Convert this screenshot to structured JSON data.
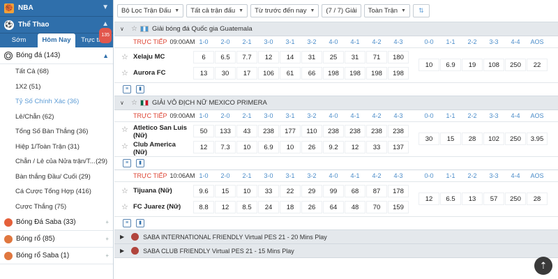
{
  "sidebar": {
    "nba_label": "NBA",
    "sport_label": "Thể Thao",
    "tabs": [
      "Sớm",
      "Hôm Nay",
      "Trực tiếp"
    ],
    "live_badge": "135",
    "football": {
      "label": "Bóng đá",
      "count": "(143)"
    },
    "menu": [
      {
        "label": "Tất Cả",
        "count": "(68)"
      },
      {
        "label": "1X2",
        "count": "(51)"
      },
      {
        "label": "Tỷ Số Chính Xác",
        "count": "(36)"
      },
      {
        "label": "Lẻ/Chẵn",
        "count": "(62)"
      },
      {
        "label": "Tổng Số Bàn Thắng",
        "count": "(36)"
      },
      {
        "label": "Hiệp 1/Toàn Trận",
        "count": "(31)"
      },
      {
        "label": "Chẵn / Lẻ của Nửa trận/T...",
        "count": "(29)"
      },
      {
        "label": "Bàn thắng Đầu/ Cuối",
        "count": "(29)"
      },
      {
        "label": "Cá Cược Tổng Hợp",
        "count": "(416)"
      },
      {
        "label": "Cược Thắng",
        "count": "(75)"
      }
    ],
    "other_sports": [
      {
        "label": "Bóng Đá Saba",
        "count": "(33)"
      },
      {
        "label": "Bóng rổ",
        "count": "(85)"
      },
      {
        "label": "Bóng rổ Saba",
        "count": "(1)"
      }
    ]
  },
  "filters": {
    "league": "Bộ Lọc Trận Đấu",
    "all_leagues": "Tất cả trận đấu",
    "sort": "Từ trước đến nay",
    "count": "(7 / 7) Giải",
    "period": "Toàn Trận"
  },
  "score_cols_left": [
    "1-0",
    "2-0",
    "2-1",
    "3-0",
    "3-1",
    "3-2",
    "4-0",
    "4-1",
    "4-2",
    "4-3"
  ],
  "score_cols_right": [
    "0-0",
    "1-1",
    "2-2",
    "3-3",
    "4-4",
    "AOS"
  ],
  "leagues": [
    {
      "name": "Giải bóng đá Quốc gia Guatemala",
      "live": "TRỰC TIẾP",
      "time": "09:00AM",
      "home": "Xelaju MC",
      "away": "Aurora FC",
      "home_odds": [
        "6",
        "6.5",
        "7.7",
        "12",
        "14",
        "31",
        "25",
        "31",
        "71",
        "180"
      ],
      "away_odds": [
        "13",
        "30",
        "17",
        "106",
        "61",
        "66",
        "198",
        "198",
        "198",
        "198"
      ],
      "draw_odds": [
        "10",
        "6.9",
        "19",
        "108",
        "250",
        "22"
      ]
    },
    {
      "name": "GIẢI VÔ ĐỊCH NỮ MEXICO PRIMERA",
      "live": "TRỰC TIẾP",
      "time": "09:00AM",
      "home": "Atletico San Luis (Nữ)",
      "away": "Club America (Nữ)",
      "home_odds": [
        "50",
        "133",
        "43",
        "238",
        "177",
        "110",
        "238",
        "238",
        "238",
        "238"
      ],
      "away_odds": [
        "12",
        "7.3",
        "10",
        "6.9",
        "10",
        "26",
        "9.2",
        "12",
        "33",
        "137"
      ],
      "draw_odds": [
        "30",
        "15",
        "28",
        "102",
        "250",
        "3.95"
      ]
    },
    {
      "live": "TRỰC TIẾP",
      "time": "10:06AM",
      "home": "Tijuana (Nữ)",
      "away": "FC Juarez (Nữ)",
      "home_odds": [
        "9.6",
        "15",
        "10",
        "33",
        "22",
        "29",
        "99",
        "68",
        "87",
        "178"
      ],
      "away_odds": [
        "8.8",
        "12",
        "8.5",
        "24",
        "18",
        "26",
        "64",
        "48",
        "70",
        "159"
      ],
      "draw_odds": [
        "12",
        "6.5",
        "13",
        "57",
        "250",
        "28"
      ]
    }
  ],
  "collapsed_leagues": [
    "SABA INTERNATIONAL FRIENDLY Virtual PES 21 - 20 Mins Play",
    "SABA CLUB FRIENDLY Virtual PES 21 - 15 Mins Play"
  ],
  "icons": {
    "league_flag": "guatemala-flag-icon",
    "scroll_top": "arrow-up-icon"
  },
  "colors": {
    "primary": "#2f6fab",
    "live": "#dd4433",
    "odds_header": "#4a8cc9"
  }
}
